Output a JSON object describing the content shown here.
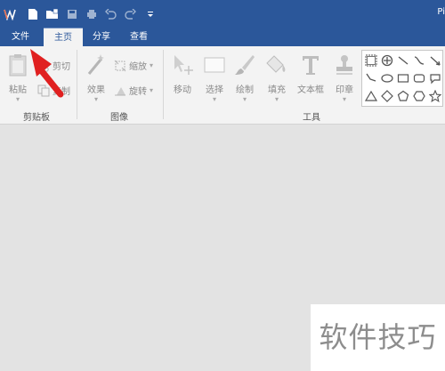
{
  "title_bar": {
    "app_title_fragment": "Pi",
    "quick_access": [
      "app-logo-icon",
      "new-file-icon",
      "open-folder-icon",
      "save-icon",
      "print-icon",
      "undo-icon",
      "redo-icon",
      "customize-icon"
    ]
  },
  "tabs": [
    {
      "label": "文件",
      "active": false
    },
    {
      "label": "主页",
      "active": true
    },
    {
      "label": "分享",
      "active": false
    },
    {
      "label": "查看",
      "active": false
    }
  ],
  "ribbon": {
    "clipboard": {
      "paste_label": "粘贴",
      "cut_label": "剪切",
      "copy_label": "复制",
      "group_label": "剪贴板"
    },
    "image": {
      "effects_label": "效果",
      "resize_label": "缩放",
      "rotate_label": "旋转",
      "group_label": "图像"
    },
    "tools": {
      "move_label": "移动",
      "select_label": "选择",
      "draw_label": "绘制",
      "fill_label": "填充",
      "text_label": "文本框",
      "stamp_label": "印章",
      "group_label": "工具"
    }
  },
  "watermark": "软件技巧",
  "colors": {
    "title_blue": "#2b579a",
    "ribbon_bg": "#f3f3f3",
    "canvas_bg": "#e3e3e3",
    "arrow_red": "#e02020"
  }
}
